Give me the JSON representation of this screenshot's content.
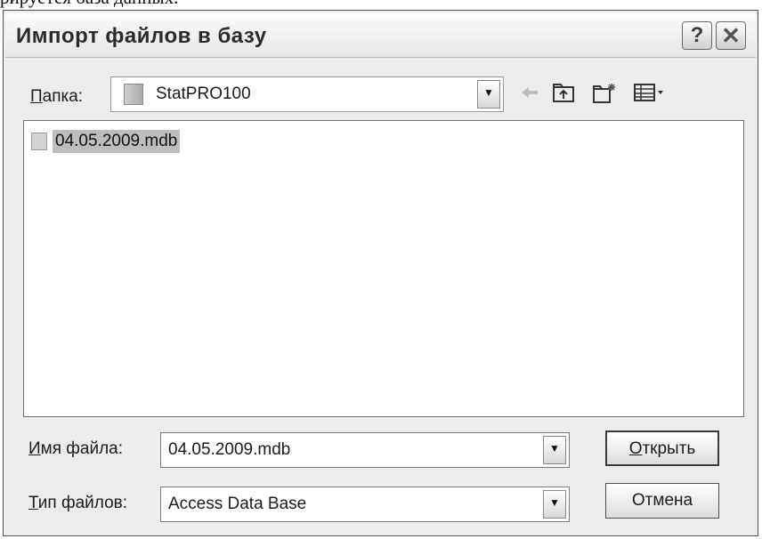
{
  "document": {
    "top_text": "рируется база данных."
  },
  "dialog": {
    "title": "Импорт файлов в базу",
    "help_label": "?",
    "close_label": "✕"
  },
  "location": {
    "label_prefix": "П",
    "label_rest": "апка:",
    "folder": "StatPRO100"
  },
  "toolbar": {
    "icons": [
      "back-arrow-icon",
      "up-folder-icon",
      "new-folder-icon",
      "view-menu-icon"
    ]
  },
  "files": [
    {
      "name": "04.05.2009.mdb",
      "selected": true
    }
  ],
  "filename": {
    "label_prefix": "И",
    "label_rest": "мя файла:",
    "value": "04.05.2009.mdb"
  },
  "filetype": {
    "label_prefix": "Т",
    "label_rest": "ип файлов:",
    "value": "Access Data Base"
  },
  "buttons": {
    "open_prefix": "О",
    "open_rest": "ткрыть",
    "cancel": "Отмена"
  }
}
